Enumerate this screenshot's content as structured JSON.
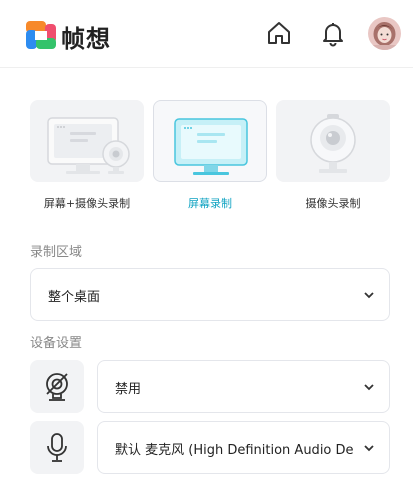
{
  "app": {
    "name": "帧想"
  },
  "header": {
    "icons": [
      "home-icon",
      "bell-icon"
    ],
    "avatar": "user-avatar"
  },
  "modes": [
    {
      "label": "屏幕+摄像头录制",
      "icon": "screen-camera-icon",
      "active": false
    },
    {
      "label": "屏幕录制",
      "icon": "screen-icon",
      "active": true
    },
    {
      "label": "摄像头录制",
      "icon": "camera-icon",
      "active": false
    }
  ],
  "record_area": {
    "title": "录制区域",
    "value": "整个桌面"
  },
  "devices": {
    "title": "设备设置",
    "camera": {
      "icon": "camera-off-icon",
      "value": "禁用"
    },
    "microphone": {
      "icon": "microphone-icon",
      "value": "默认 麦克风 (High Definition Audio De"
    }
  },
  "colors": {
    "accent": "#10a3c2",
    "logo_orange": "#f7892b",
    "logo_blue": "#2d8cf0",
    "logo_green": "#34c36b",
    "logo_pink": "#f04e6e"
  }
}
